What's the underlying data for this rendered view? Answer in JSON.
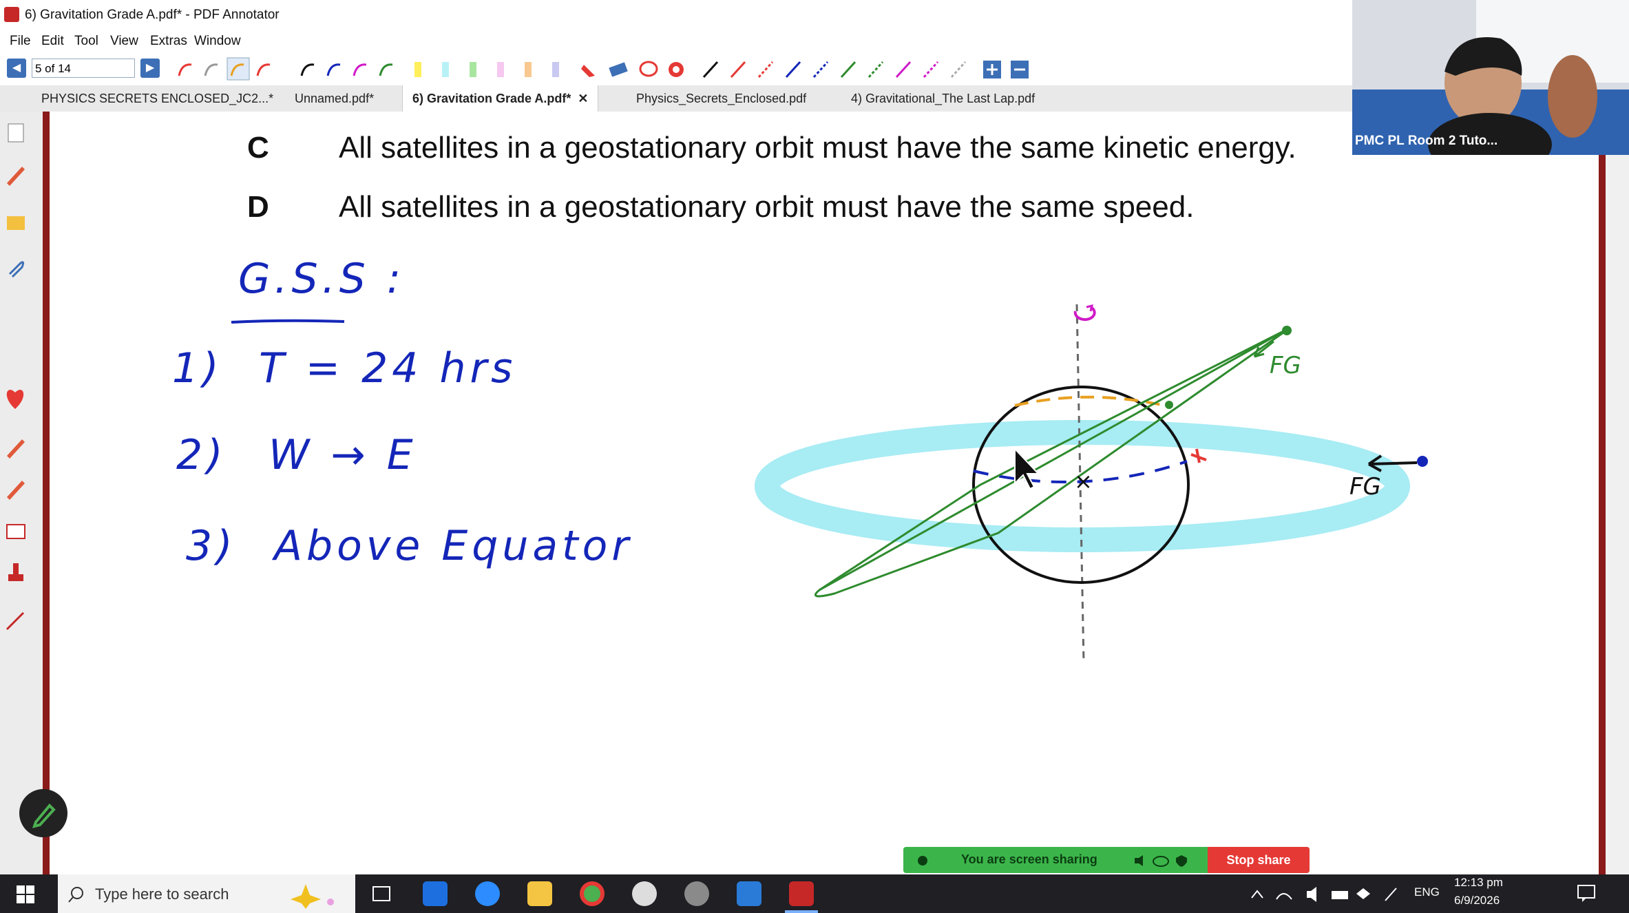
{
  "window": {
    "title": "6) Gravitation Grade A.pdf* - PDF Annotator"
  },
  "menu": [
    "File",
    "Edit",
    "Tool",
    "View",
    "Extras",
    "Window"
  ],
  "nav": {
    "page_indicator": "5 of 14"
  },
  "tabs": [
    {
      "label": "PHYSICS SECRETS ENCLOSED_JC2...*"
    },
    {
      "label": "Unnamed.pdf*"
    },
    {
      "label": "6) Gravitation Grade A.pdf*",
      "close": "✕"
    },
    {
      "label": "Physics_Secrets_Enclosed.pdf"
    },
    {
      "label": "4) Gravitational_The Last Lap.pdf"
    }
  ],
  "question": {
    "options": [
      {
        "letter": "C",
        "text": "All satellites in a geostationary orbit must have the same kinetic energy."
      },
      {
        "letter": "D",
        "text": "All satellites in a geostationary orbit must have the same speed."
      }
    ]
  },
  "notes": {
    "heading": "G.S.S :",
    "items": [
      {
        "number": "1)",
        "text": "T = 24 hrs"
      },
      {
        "number": "2)",
        "text": "W → E"
      },
      {
        "number": "3)",
        "text": "Above Equator"
      }
    ],
    "diagram_labels": {
      "fg_top": "FG",
      "fg_right": "FG",
      "center_mark": "×"
    }
  },
  "share": {
    "status": "You are screen sharing",
    "stop_label": "Stop share"
  },
  "webcam": {
    "label": "PMC PL Room 2 Tuto..."
  },
  "taskbar": {
    "search_placeholder": "Type here to search",
    "language": "ENG",
    "time": "12:13 pm",
    "date": "6/9/2026"
  },
  "colors": {
    "ink_blue": "#1426b8",
    "ink_green": "#2e8b2e",
    "ink_magenta": "#d01ac8",
    "ink_orange": "#e8a020",
    "ink_red": "#e53935",
    "orbit_cyan": "#a8ecf4"
  }
}
